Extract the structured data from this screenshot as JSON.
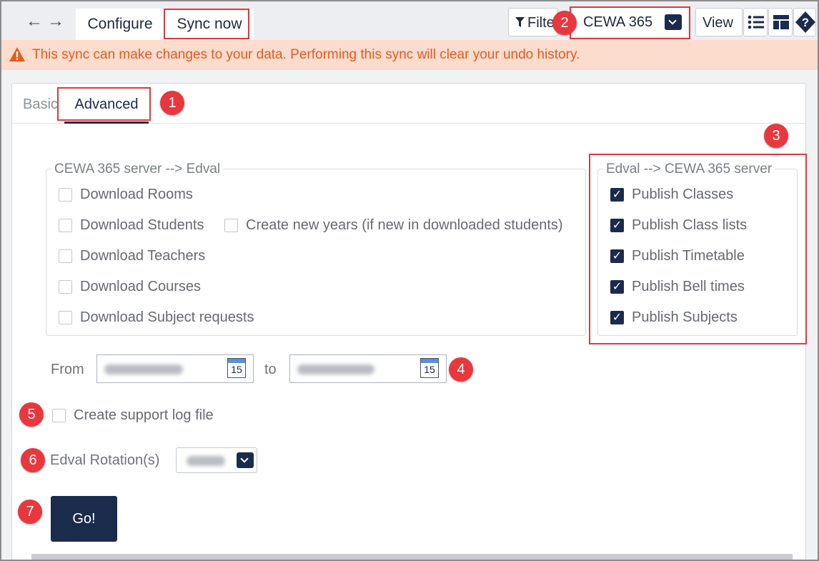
{
  "toolbar": {
    "back_glyph": "←",
    "forward_glyph": "→",
    "tabs": [
      {
        "label": "Configure"
      },
      {
        "label": "Sync now"
      }
    ],
    "filter_label": "Filter",
    "filter_visible": "Filte",
    "dataset_label": "CEWA 365",
    "view_label": "View"
  },
  "warning": {
    "text": "This sync can make changes to your data. Performing this sync will clear your undo history.",
    "color": "#e85a1f",
    "icon": "warning-triangle-icon"
  },
  "subtabs": [
    {
      "label": "Basic",
      "visible": "Basic"
    },
    {
      "label": "Advanced"
    }
  ],
  "download_group": {
    "legend": "CEWA 365 server --> Edval",
    "items": [
      {
        "label": "Download Rooms",
        "checked": false
      },
      {
        "label": "Download Students",
        "checked": false
      },
      {
        "label": "Create new years (if new in downloaded students)",
        "checked": false
      },
      {
        "label": "Download Teachers",
        "checked": false
      },
      {
        "label": "Download Courses",
        "checked": false
      },
      {
        "label": "Download Subject requests",
        "checked": false
      }
    ]
  },
  "publish_group": {
    "legend": "Edval --> CEWA 365 server",
    "items": [
      {
        "label": "Publish Classes",
        "checked": true
      },
      {
        "label": "Publish Class lists",
        "checked": true
      },
      {
        "label": "Publish Timetable",
        "checked": true
      },
      {
        "label": "Publish Bell times",
        "checked": true
      },
      {
        "label": "Publish Subjects",
        "checked": true
      }
    ]
  },
  "date_range": {
    "from_label": "From",
    "to_label": "to",
    "calendar_day": "15"
  },
  "support_log": {
    "label": "Create support log file",
    "checked": false
  },
  "rotation": {
    "label": "Edval Rotation(s)"
  },
  "go_button": {
    "label": "Go!"
  },
  "callouts": [
    "1",
    "2",
    "3",
    "4",
    "5",
    "6",
    "7"
  ],
  "colors": {
    "accent": "#1b2b4b",
    "callout": "#e8373d",
    "warning_bg": "#fbdccd"
  }
}
